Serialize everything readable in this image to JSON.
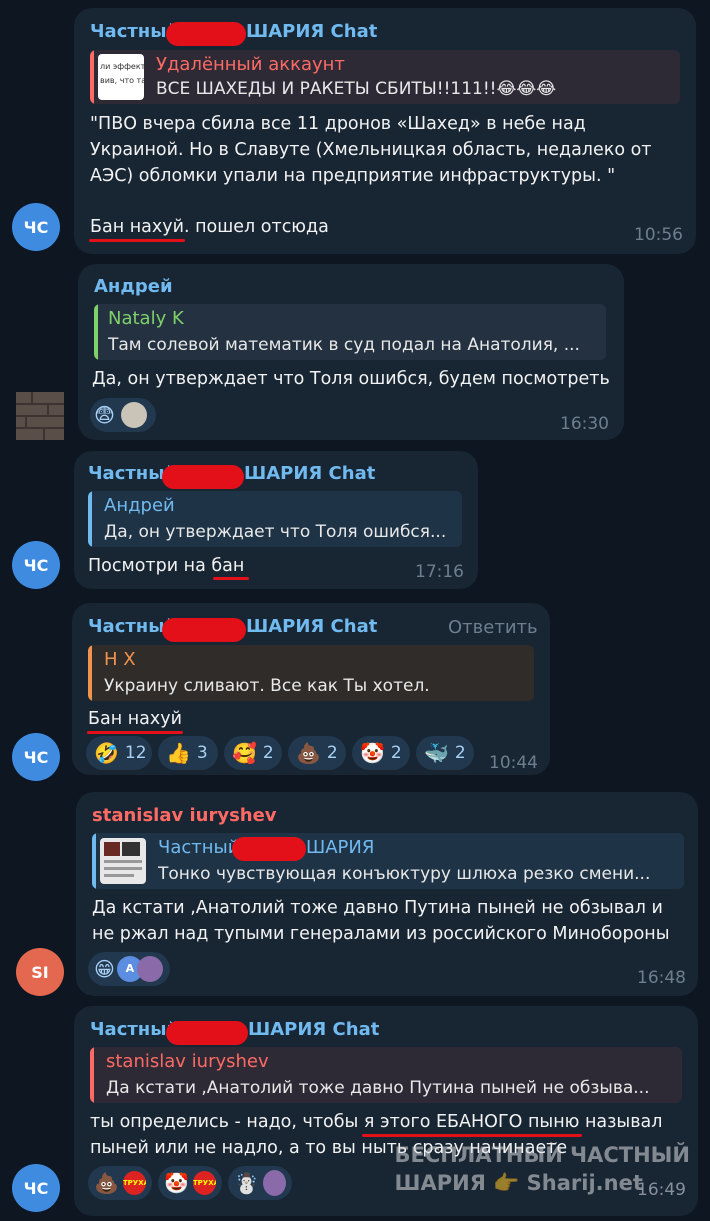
{
  "colors": {
    "background": "#0e1621",
    "bubble": "#182533",
    "sender_blue": "#71baf0",
    "sender_red": "#ff6a64",
    "quote_red": "#ff6a64",
    "quote_green": "#7fd16a",
    "quote_orange": "#f0934e",
    "redaction": "#e3101a"
  },
  "messages": [
    {
      "sender": "Частный ШАРИЯ Chat",
      "sender_parts": [
        "Частный",
        "ШАРИЯ Chat"
      ],
      "avatar": "ЧС",
      "quote": {
        "name": "Удалённый аккаунт",
        "text": "ВСЕ ШАХЕДЫ И РАКЕТЫ СБИТЫ!!111!!😂😂😂",
        "thumb_text": "ли эффекти\nвив, что та"
      },
      "body_lines": [
        "\"ПВО вчера сбила все 11 дронов «Шахед» в небе над",
        "Украиной. Но в Славуте (Хмельницкая область, недалеко от",
        "АЭС) обломки упали на предприятие инфраструктуры. \""
      ],
      "body_last": "Бан нахуй. пошел отсюда",
      "time": "10:56"
    },
    {
      "sender": "Андрей",
      "quote": {
        "name": "Nataly K",
        "text": "Там солевой математик в суд подал на Анатолия, ..."
      },
      "body": "Да, он утверждает что Толя ошибся, будем посмотреть",
      "reaction_emoji": "😨",
      "time": "16:30"
    },
    {
      "sender_parts": [
        "Частный",
        "ШАРИЯ Chat"
      ],
      "avatar": "ЧС",
      "quote": {
        "name": "Андрей",
        "text": "Да, он утверждает что Толя ошибся..."
      },
      "body_prefix": "Посмотри на ",
      "body_highlight": "бан",
      "time": "17:16"
    },
    {
      "sender_parts": [
        "Частный",
        "ШАРИЯ Chat"
      ],
      "reply": "Ответить",
      "avatar": "ЧС",
      "quote": {
        "name": "Н Х",
        "text": "Украину сливают. Все как Ты хотел."
      },
      "body": "Бан нахуй",
      "reactions": [
        {
          "emoji": "🤣",
          "count": "12"
        },
        {
          "emoji": "👍",
          "count": "3"
        },
        {
          "emoji": "🥰",
          "count": "2"
        },
        {
          "emoji": "💩",
          "count": "2"
        },
        {
          "emoji": "🤡",
          "count": "2"
        },
        {
          "emoji": "🐳",
          "count": "2"
        }
      ],
      "time": "10:44"
    },
    {
      "sender": "stanislav iuryshev",
      "avatar": "SI",
      "quote": {
        "name_parts": [
          "Частный",
          "ШАРИЯ"
        ],
        "text": "Тонко чувствующая конъюктуру шлюха резко смени..."
      },
      "body_lines": [
        "Да кстати ,Анатолий тоже давно Путина пыней не обзывал и",
        "не ржал над тупыми генералами из российского Минобороны"
      ],
      "reaction_emoji": "😁",
      "reaction_avatar_letter": "A",
      "time": "16:48"
    },
    {
      "sender_parts": [
        "Частный",
        "ШАРИЯ Chat"
      ],
      "avatar": "ЧС",
      "quote": {
        "name": "stanislav iuryshev",
        "text": "Да кстати ,Анатолий тоже давно Путина пыней не обзыва..."
      },
      "body_line1_a": "ты определись - надо, чтобы ",
      "body_line1_b": "я этого ЕБАНОГО пыню",
      "body_line1_c": " называл",
      "body_line2": "пыней или не надлo, а то вы ныть сразу начинаете",
      "reactions": [
        "💩",
        "🤡",
        "☃️"
      ],
      "sticker_text": "ТРУХА",
      "time": "16:49"
    }
  ],
  "watermark": {
    "line1": "БЕСПЛАТНЫЙ ЧАСТНЫЙ",
    "line2": "ШАРИЯ 👉 Sharij.net"
  }
}
